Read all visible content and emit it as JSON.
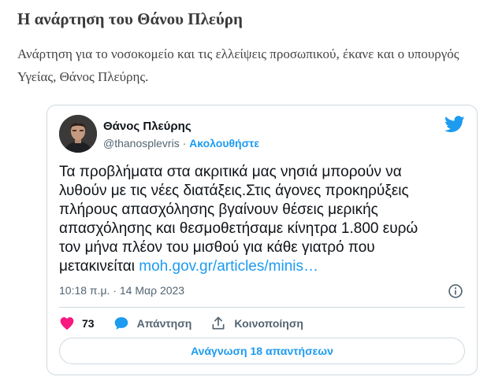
{
  "article": {
    "title": "Η ανάρτηση του Θάνου Πλεύρη",
    "text": "Ανάρτηση για το νοσοκομείο και τις ελλείψεις προσωπικού, έκανε και ο υπουργός Υγείας, Θάνος Πλεύρης."
  },
  "tweet": {
    "author_name": "Θάνος Πλεύρης",
    "handle": "@thanosplevris",
    "separator": "·",
    "follow_label": "Ακολουθήστε",
    "text": "Τα προβλήματα στα ακριτικά μας νησιά μπορούν να λυθούν με τις νέες διατάξεις.Στις άγονες προκηρύξεις πλήρους απασχόλησης βγαίνουν θέσεις μερικής απασχόλησης και θεσμοθετήσαμε κίνητρα 1.800 ευρώ τον μήνα πλέον του μισθού για κάθε γιατρό που μετακινείται",
    "link": "moh.gov.gr/articles/minis…",
    "timestamp": "10:18 π.μ. · 14 Μαρ 2023",
    "likes": "73",
    "reply_label": "Απάντηση",
    "share_label": "Κοινοποίηση",
    "read_replies_label": "Ανάγνωση 18 απαντήσεων"
  },
  "colors": {
    "twitter_blue": "#1d9bf0",
    "like_red": "#f91880",
    "text_dark": "#0f1419",
    "text_gray": "#536471",
    "border": "#cfd9de"
  },
  "icons": {
    "brand": "twitter-bird-icon",
    "info": "info-icon",
    "like": "heart-icon",
    "reply": "speech-bubble-icon",
    "share": "share-upload-icon"
  }
}
